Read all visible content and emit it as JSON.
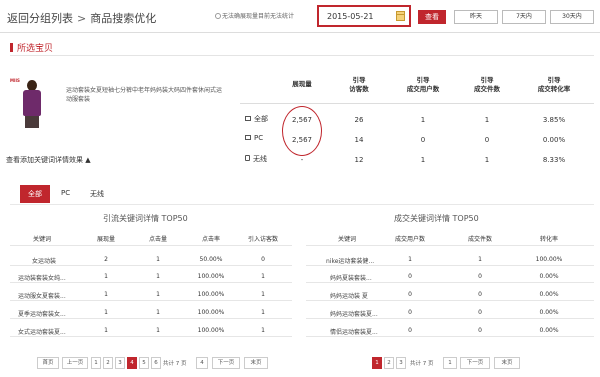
{
  "header": {
    "breadcrumb_back": "返回分组列表",
    "breadcrumb_sep": ">",
    "breadcrumb_current": "商品搜索优化",
    "checkbox_label": "无法确展现量目前无法统计",
    "date_value": "2015-05-21",
    "query_button": "查看",
    "range_options": [
      "昨天",
      "7天内",
      "30天内"
    ]
  },
  "section": {
    "title": "所选宝贝"
  },
  "product": {
    "brand": "MIIS",
    "title": "运动套装女夏短袖七分裤中老年妈妈装大码四件套休闲式运动服套装"
  },
  "stats": {
    "headers": [
      "展现量",
      "引导\n访客数",
      "引导\n成交用户数",
      "引导\n成交件数",
      "引导\n成交转化率"
    ],
    "rows": [
      {
        "device": "全部",
        "icon": "monitor-icon",
        "impressions": "2,567",
        "visitors": "26",
        "buyers": "1",
        "items": "1",
        "conversion": "3.85%"
      },
      {
        "device": "PC",
        "icon": "monitor-icon",
        "impressions": "2,567",
        "visitors": "14",
        "buyers": "0",
        "items": "0",
        "conversion": "0.00%"
      },
      {
        "device": "无线",
        "icon": "wireless-icon",
        "impressions": "-",
        "visitors": "12",
        "buyers": "1",
        "items": "1",
        "conversion": "8.33%"
      }
    ],
    "keyword_effect_link": "查看添加关键词详情效果 ▲"
  },
  "tabs": [
    "全部",
    "PC",
    "无线"
  ],
  "left_table": {
    "title": "引流关键词详情 TOP50",
    "columns": [
      "关键词",
      "展现量",
      "点击量",
      "点击率",
      "引入访客数"
    ],
    "rows": [
      [
        "女运动装",
        "2",
        "1",
        "50.00%",
        "0"
      ],
      [
        "运动装套装女纯...",
        "1",
        "1",
        "100.00%",
        "1"
      ],
      [
        "运动服女夏套装...",
        "1",
        "1",
        "100.00%",
        "1"
      ],
      [
        "夏季运动套装女...",
        "1",
        "1",
        "100.00%",
        "1"
      ],
      [
        "女式运动套装夏...",
        "1",
        "1",
        "100.00%",
        "1"
      ]
    ],
    "pagination": {
      "first": "首页",
      "prev": "上一页",
      "pages": [
        "1",
        "2",
        "3",
        "4",
        "5",
        "6"
      ],
      "current": "4",
      "total_label": "共计 7 页",
      "jump_value": "4",
      "next": "下一页",
      "last": "末页"
    }
  },
  "right_table": {
    "title": "成交关键词详情 TOP50",
    "columns": [
      "关键词",
      "成交用户数",
      "成交件数",
      "转化率"
    ],
    "rows": [
      [
        "nike运动套装健...",
        "1",
        "1",
        "100.00%"
      ],
      [
        "妈妈夏装套装...",
        "0",
        "0",
        "0.00%"
      ],
      [
        "妈妈运动装 夏",
        "0",
        "0",
        "0.00%"
      ],
      [
        "妈妈运动套装夏...",
        "0",
        "0",
        "0.00%"
      ],
      [
        "情侣运动套装夏...",
        "0",
        "0",
        "0.00%"
      ]
    ],
    "pagination": {
      "pages": [
        "1",
        "2",
        "3"
      ],
      "current": "1",
      "total_label": "共计 7 页",
      "jump_value": "1",
      "next": "下一页",
      "last": "末页"
    }
  }
}
